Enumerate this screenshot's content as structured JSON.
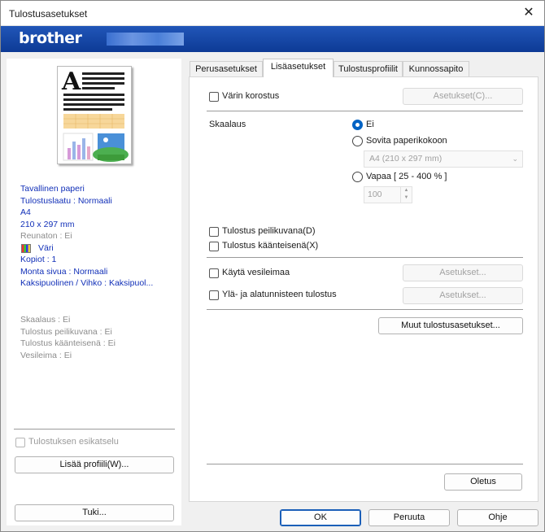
{
  "window": {
    "title": "Tulostusasetukset",
    "close_glyph": "✕"
  },
  "banner": {
    "brand": "brother"
  },
  "tabs": [
    {
      "label": "Perusasetukset"
    },
    {
      "label": "Lisäasetukset"
    },
    {
      "label": "Tulostusprofiilit"
    },
    {
      "label": "Kunnossapito"
    }
  ],
  "left": {
    "info": {
      "media": "Tavallinen paperi",
      "quality": "Tulostuslaatu : Normaali",
      "size": "A4",
      "dimensions": "210 x 297 mm",
      "borderless": "Reunaton : Ei",
      "color": "Väri",
      "copies": "Kopiot : 1",
      "multipage": "Monta sivua : Normaali",
      "duplex": "Kaksipuolinen / Vihko : Kaksipuol..."
    },
    "advanced_summary": {
      "scaling": "Skaalaus : Ei",
      "mirror": "Tulostus peilikuvana : Ei",
      "reverse": "Tulostus käänteisenä : Ei",
      "watermark": "Vesileima : Ei"
    },
    "preview_checkbox": "Tulostuksen esikatselu",
    "add_profile_button": "Lisää profiili(W)...",
    "support_button": "Tuki..."
  },
  "advanced": {
    "color_enhance": {
      "label": "Värin korostus",
      "settings_button": "Asetukset(C)..."
    },
    "scaling": {
      "label": "Skaalaus",
      "off": "Ei",
      "fit": "Sovita paperikokoon",
      "fit_size": "A4 (210 x 297 mm)",
      "free": "Vapaa [ 25 - 400 % ]",
      "free_value": "100",
      "selected": "Ei"
    },
    "mirror": "Tulostus peilikuvana(D)",
    "reverse": "Tulostus käänteisenä(X)",
    "watermark": {
      "label": "Käytä vesileimaa",
      "settings_button": "Asetukset..."
    },
    "header_footer": {
      "label": "Ylä- ja alatunnisteen tulostus",
      "settings_button": "Asetukset..."
    },
    "other_button": "Muut tulostusasetukset...",
    "default_button": "Oletus"
  },
  "footer": {
    "ok": "OK",
    "cancel": "Peruuta",
    "help": "Ohje"
  },
  "colors": {
    "brand_blue": "#0d3a95",
    "info_blue": "#1230b8",
    "radio_blue": "#0063c4"
  }
}
